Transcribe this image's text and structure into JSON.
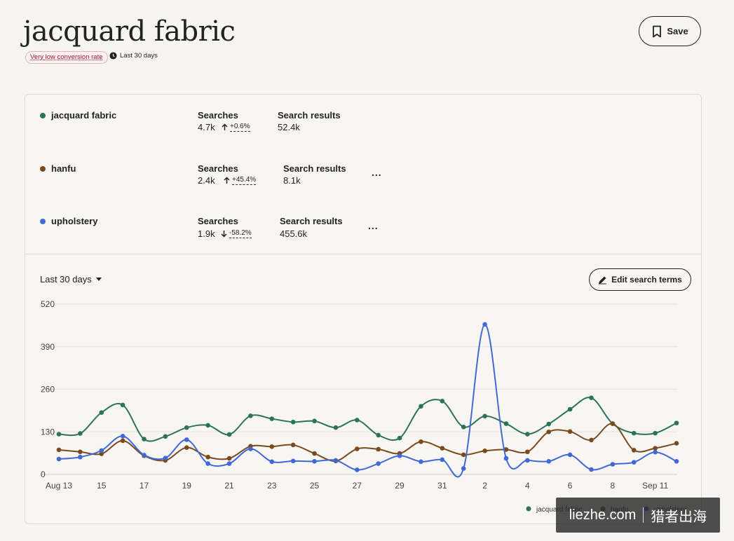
{
  "page": {
    "title": "jacquard fabric",
    "badge": "Very low conversion rate",
    "period": "Last 30 days",
    "save_label": "Save"
  },
  "terms": [
    {
      "name": "jacquard fabric",
      "color": "#2e7358",
      "searches_label": "Searches",
      "searches": "4.7k",
      "direction": "up",
      "change": "+0.6%",
      "results_label": "Search results",
      "results": "52.4k"
    },
    {
      "name": "hanfu",
      "color": "#7a4a1e",
      "searches_label": "Searches",
      "searches": "2.4k",
      "direction": "up",
      "change": "+45.4%",
      "results_label": "Search results",
      "results": "8.1k",
      "more": "..."
    },
    {
      "name": "upholstery",
      "color": "#4169d6",
      "searches_label": "Searches",
      "searches": "1.9k",
      "direction": "down",
      "change": "-58.2%",
      "results_label": "Search results",
      "results": "455.6k",
      "more": "..."
    }
  ],
  "controls": {
    "range": "Last 30 days",
    "edit_label": "Edit search terms"
  },
  "chart_data": {
    "type": "line",
    "yticks": [
      0,
      130,
      260,
      390,
      520
    ],
    "ylim": [
      0,
      520
    ],
    "xtick_labels": [
      "Aug 13",
      "15",
      "17",
      "19",
      "21",
      "23",
      "25",
      "27",
      "29",
      "31",
      "2",
      "4",
      "6",
      "8",
      "Sep 11"
    ],
    "x": [
      "Aug 13",
      "Aug 14",
      "Aug 15",
      "Aug 16",
      "Aug 17",
      "Aug 18",
      "Aug 19",
      "Aug 20",
      "Aug 21",
      "Aug 22",
      "Aug 23",
      "Aug 24",
      "Aug 25",
      "Aug 26",
      "Aug 27",
      "Aug 28",
      "Aug 29",
      "Aug 30",
      "Aug 31",
      "Sep 1",
      "Sep 2",
      "Sep 3",
      "Sep 4",
      "Sep 5",
      "Sep 6",
      "Sep 7",
      "Sep 8",
      "Sep 9",
      "Sep 10",
      "Sep 11"
    ],
    "series": [
      {
        "name": "jacquard fabric",
        "color": "#2e7358",
        "values": [
          123,
          125,
          189,
          212,
          108,
          116,
          143,
          150,
          122,
          179,
          170,
          160,
          163,
          143,
          166,
          120,
          111,
          208,
          224,
          145,
          178,
          155,
          123,
          154,
          199,
          234,
          155,
          126,
          126,
          157
        ]
      },
      {
        "name": "hanfu",
        "color": "#7a4a1e",
        "values": [
          75,
          69,
          63,
          103,
          57,
          43,
          82,
          53,
          49,
          86,
          85,
          90,
          64,
          41,
          78,
          77,
          64,
          100,
          80,
          60,
          72,
          76,
          69,
          130,
          131,
          105,
          155,
          74,
          80,
          95
        ]
      },
      {
        "name": "upholstery",
        "color": "#4169d6",
        "values": [
          47,
          53,
          73,
          117,
          59,
          50,
          106,
          33,
          33,
          78,
          39,
          41,
          40,
          43,
          14,
          33,
          57,
          39,
          45,
          18,
          458,
          49,
          43,
          40,
          60,
          15,
          31,
          37,
          68,
          40
        ]
      }
    ],
    "legend": [
      "jacquard fabric",
      "hanfu",
      "upholstery"
    ],
    "legend_position": "bottom-right",
    "grid": true
  },
  "watermark": {
    "left": "liezhe.com",
    "right": "猎者出海"
  }
}
